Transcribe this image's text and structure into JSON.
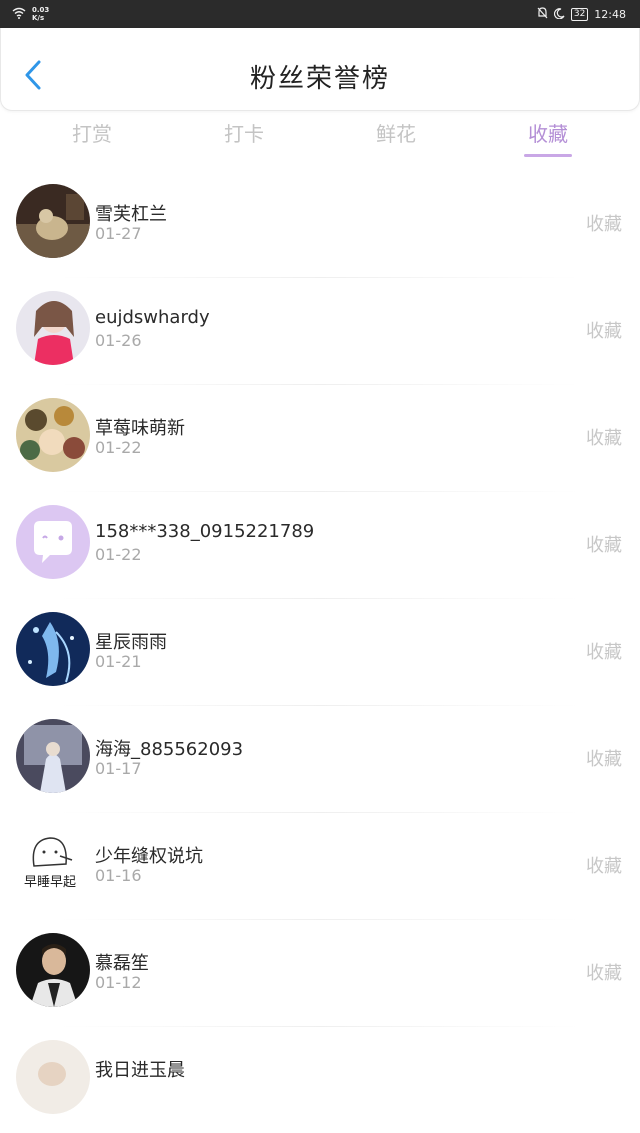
{
  "status_bar": {
    "net_speed": "0.03",
    "net_unit": "K/s",
    "battery": "32",
    "time": "12:48"
  },
  "header": {
    "title": "粉丝荣誉榜"
  },
  "tabs": [
    {
      "label": "打赏",
      "active": false
    },
    {
      "label": "打卡",
      "active": false
    },
    {
      "label": "鲜花",
      "active": false
    },
    {
      "label": "收藏",
      "active": true
    }
  ],
  "list": [
    {
      "name": "雪芙杠兰",
      "date": "01-27",
      "action": "收藏",
      "avatar_icon": "photo-avatar-icon"
    },
    {
      "name": "eujdswhardy",
      "date": "01-26",
      "action": "收藏",
      "avatar_icon": "photo-avatar-icon"
    },
    {
      "name": "草莓味萌新",
      "date": "01-22",
      "action": "收藏",
      "avatar_icon": "photo-avatar-icon"
    },
    {
      "name": "158***338_0915221789",
      "date": "01-22",
      "action": "收藏",
      "avatar_icon": "chat-bubble-avatar-icon"
    },
    {
      "name": "星辰雨雨",
      "date": "01-21",
      "action": "收藏",
      "avatar_icon": "photo-avatar-icon"
    },
    {
      "name": "海海_885562093",
      "date": "01-17",
      "action": "收藏",
      "avatar_icon": "photo-avatar-icon"
    },
    {
      "name": "少年缝权说坑",
      "date": "01-16",
      "action": "收藏",
      "avatar_icon": "sketch-avatar-icon",
      "avatar_caption": "早睡早起"
    },
    {
      "name": "慕磊笙",
      "date": "01-12",
      "action": "收藏",
      "avatar_icon": "photo-avatar-icon"
    },
    {
      "name": "我日进玉晨",
      "date": "",
      "action": "",
      "avatar_icon": "photo-avatar-icon"
    }
  ],
  "colors": {
    "accent": "#b48fd6",
    "back_arrow": "#2f96e8",
    "inactive_tab": "#c4c4c4"
  }
}
